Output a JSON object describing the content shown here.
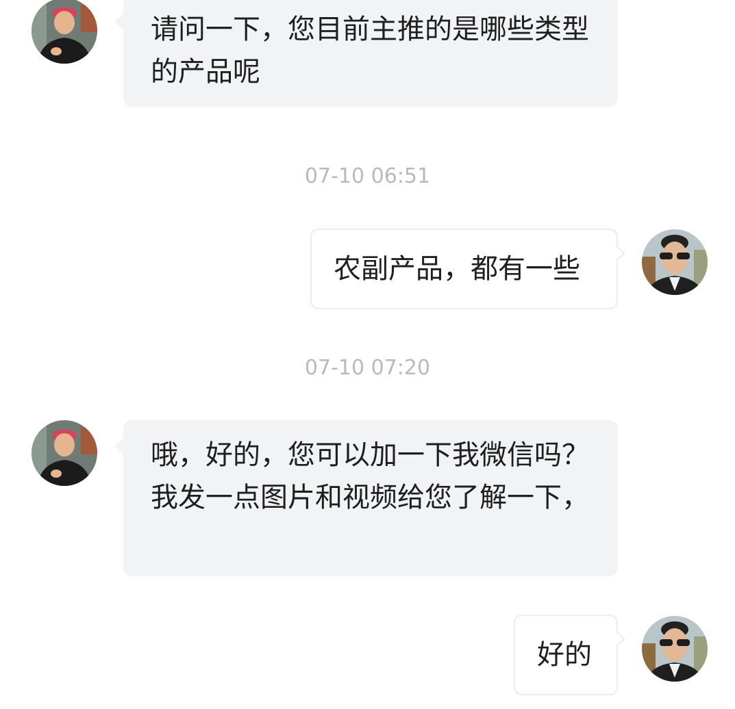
{
  "messages": [
    {
      "sender": "contact",
      "avatar_icon": "avatar-man-red-cap-icon",
      "text": "请问一下，您目前主推的是哪些类型的产品呢"
    },
    {
      "timestamp": "07-10 06:51"
    },
    {
      "sender": "self",
      "avatar_icon": "avatar-man-sunglasses-icon",
      "text": "农副产品，都有一些"
    },
    {
      "timestamp": "07-10 07:20"
    },
    {
      "sender": "contact",
      "avatar_icon": "avatar-man-red-cap-icon",
      "text": "哦，好的，您可以加一下我微信吗？我发一点图片和视频给您了解一下，"
    },
    {
      "sender": "self",
      "avatar_icon": "avatar-man-sunglasses-icon",
      "text": "好的"
    }
  ],
  "colors": {
    "incoming_bubble": "#f2f3f5",
    "outgoing_bubble": "#ffffff",
    "outgoing_border": "#ececec",
    "timestamp_text": "#b9b9b9",
    "message_text": "#1f1f1f"
  }
}
